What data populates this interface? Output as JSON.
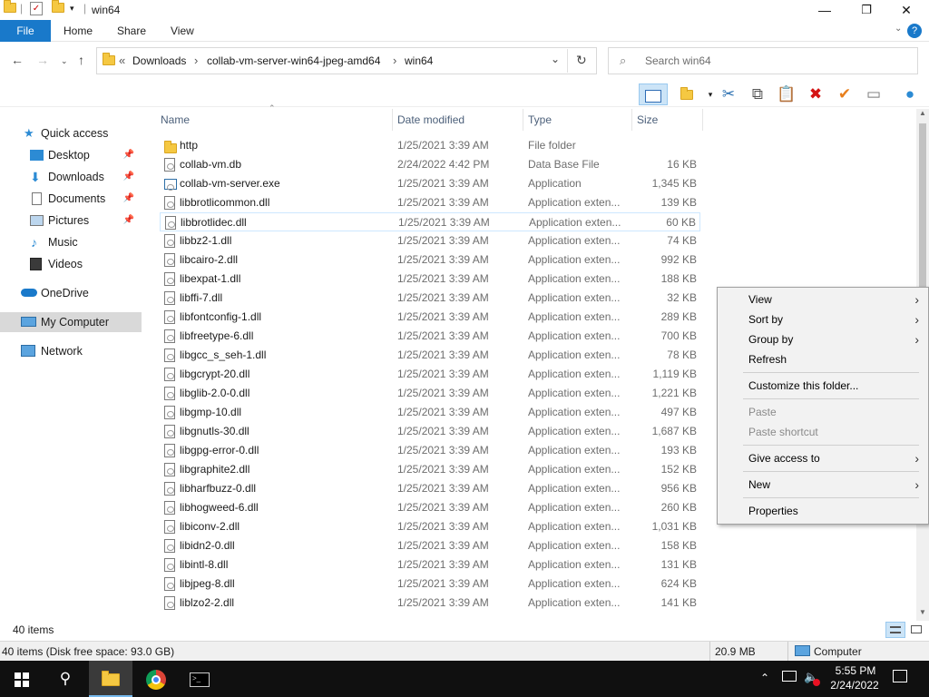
{
  "window": {
    "title": "win64",
    "controls": {
      "minimize": "—",
      "maximize": "❐",
      "close": "✕"
    }
  },
  "ribbon": {
    "tabs": [
      "File",
      "Home",
      "Share",
      "View"
    ]
  },
  "address": {
    "overflow": "«",
    "crumbs": [
      "Downloads",
      "collab-vm-server-win64-jpeg-amd64",
      "win64"
    ],
    "separator": "›",
    "search_placeholder": "Search win64"
  },
  "nav": {
    "items": [
      {
        "label": "Quick access",
        "icon": "star-icon",
        "pinned": false
      },
      {
        "label": "Desktop",
        "icon": "desktop-icon",
        "pinned": true
      },
      {
        "label": "Downloads",
        "icon": "download-icon",
        "pinned": true
      },
      {
        "label": "Documents",
        "icon": "documents-icon",
        "pinned": true
      },
      {
        "label": "Pictures",
        "icon": "pictures-icon",
        "pinned": true
      },
      {
        "label": "Music",
        "icon": "music-icon",
        "pinned": false
      },
      {
        "label": "Videos",
        "icon": "videos-icon",
        "pinned": false
      },
      {
        "label": "OneDrive",
        "icon": "cloud-icon",
        "pinned": false
      },
      {
        "label": "My Computer",
        "icon": "computer-icon",
        "pinned": false
      },
      {
        "label": "Network",
        "icon": "network-icon",
        "pinned": false
      }
    ]
  },
  "columns": {
    "name": "Name",
    "date": "Date modified",
    "type": "Type",
    "size": "Size"
  },
  "files": [
    {
      "name": "http",
      "date": "1/25/2021 3:39 AM",
      "type": "File folder",
      "size": "",
      "kind": "folder"
    },
    {
      "name": "collab-vm.db",
      "date": "2/24/2022 4:42 PM",
      "type": "Data Base File",
      "size": "16 KB",
      "kind": "file"
    },
    {
      "name": "collab-vm-server.exe",
      "date": "1/25/2021 3:39 AM",
      "type": "Application",
      "size": "1,345 KB",
      "kind": "exe"
    },
    {
      "name": "libbrotlicommon.dll",
      "date": "1/25/2021 3:39 AM",
      "type": "Application exten...",
      "size": "139 KB",
      "kind": "file"
    },
    {
      "name": "libbrotlidec.dll",
      "date": "1/25/2021 3:39 AM",
      "type": "Application exten...",
      "size": "60 KB",
      "kind": "file"
    },
    {
      "name": "libbz2-1.dll",
      "date": "1/25/2021 3:39 AM",
      "type": "Application exten...",
      "size": "74 KB",
      "kind": "file"
    },
    {
      "name": "libcairo-2.dll",
      "date": "1/25/2021 3:39 AM",
      "type": "Application exten...",
      "size": "992 KB",
      "kind": "file"
    },
    {
      "name": "libexpat-1.dll",
      "date": "1/25/2021 3:39 AM",
      "type": "Application exten...",
      "size": "188 KB",
      "kind": "file"
    },
    {
      "name": "libffi-7.dll",
      "date": "1/25/2021 3:39 AM",
      "type": "Application exten...",
      "size": "32 KB",
      "kind": "file"
    },
    {
      "name": "libfontconfig-1.dll",
      "date": "1/25/2021 3:39 AM",
      "type": "Application exten...",
      "size": "289 KB",
      "kind": "file"
    },
    {
      "name": "libfreetype-6.dll",
      "date": "1/25/2021 3:39 AM",
      "type": "Application exten...",
      "size": "700 KB",
      "kind": "file"
    },
    {
      "name": "libgcc_s_seh-1.dll",
      "date": "1/25/2021 3:39 AM",
      "type": "Application exten...",
      "size": "78 KB",
      "kind": "file"
    },
    {
      "name": "libgcrypt-20.dll",
      "date": "1/25/2021 3:39 AM",
      "type": "Application exten...",
      "size": "1,119 KB",
      "kind": "file"
    },
    {
      "name": "libglib-2.0-0.dll",
      "date": "1/25/2021 3:39 AM",
      "type": "Application exten...",
      "size": "1,221 KB",
      "kind": "file"
    },
    {
      "name": "libgmp-10.dll",
      "date": "1/25/2021 3:39 AM",
      "type": "Application exten...",
      "size": "497 KB",
      "kind": "file"
    },
    {
      "name": "libgnutls-30.dll",
      "date": "1/25/2021 3:39 AM",
      "type": "Application exten...",
      "size": "1,687 KB",
      "kind": "file"
    },
    {
      "name": "libgpg-error-0.dll",
      "date": "1/25/2021 3:39 AM",
      "type": "Application exten...",
      "size": "193 KB",
      "kind": "file"
    },
    {
      "name": "libgraphite2.dll",
      "date": "1/25/2021 3:39 AM",
      "type": "Application exten...",
      "size": "152 KB",
      "kind": "file"
    },
    {
      "name": "libharfbuzz-0.dll",
      "date": "1/25/2021 3:39 AM",
      "type": "Application exten...",
      "size": "956 KB",
      "kind": "file"
    },
    {
      "name": "libhogweed-6.dll",
      "date": "1/25/2021 3:39 AM",
      "type": "Application exten...",
      "size": "260 KB",
      "kind": "file"
    },
    {
      "name": "libiconv-2.dll",
      "date": "1/25/2021 3:39 AM",
      "type": "Application exten...",
      "size": "1,031 KB",
      "kind": "file"
    },
    {
      "name": "libidn2-0.dll",
      "date": "1/25/2021 3:39 AM",
      "type": "Application exten...",
      "size": "158 KB",
      "kind": "file"
    },
    {
      "name": "libintl-8.dll",
      "date": "1/25/2021 3:39 AM",
      "type": "Application exten...",
      "size": "131 KB",
      "kind": "file"
    },
    {
      "name": "libjpeg-8.dll",
      "date": "1/25/2021 3:39 AM",
      "type": "Application exten...",
      "size": "624 KB",
      "kind": "file"
    },
    {
      "name": "liblzo2-2.dll",
      "date": "1/25/2021 3:39 AM",
      "type": "Application exten...",
      "size": "141 KB",
      "kind": "file"
    }
  ],
  "selected_index": 4,
  "status": {
    "item_count": "40 items",
    "disk_info": "40 items (Disk free space: 93.0 GB)",
    "size_total": "20.9 MB",
    "location": "Computer"
  },
  "context_menu": {
    "items": [
      {
        "label": "View",
        "submenu": true,
        "disabled": false
      },
      {
        "label": "Sort by",
        "submenu": true,
        "disabled": false
      },
      {
        "label": "Group by",
        "submenu": true,
        "disabled": false
      },
      {
        "label": "Refresh",
        "submenu": false,
        "disabled": false
      },
      {
        "label": "Customize this folder...",
        "submenu": false,
        "disabled": false
      },
      {
        "label": "Paste",
        "submenu": false,
        "disabled": true
      },
      {
        "label": "Paste shortcut",
        "submenu": false,
        "disabled": true
      },
      {
        "label": "Give access to",
        "submenu": true,
        "disabled": false
      },
      {
        "label": "New",
        "submenu": true,
        "disabled": false
      },
      {
        "label": "Properties",
        "submenu": false,
        "disabled": false
      }
    ]
  },
  "taskbar": {
    "time": "5:55 PM",
    "date": "2/24/2022"
  },
  "colors": {
    "accent": "#1979ca",
    "folder": "#f5c842",
    "selection_border": "#cde8ff",
    "taskbar": "#101010"
  }
}
